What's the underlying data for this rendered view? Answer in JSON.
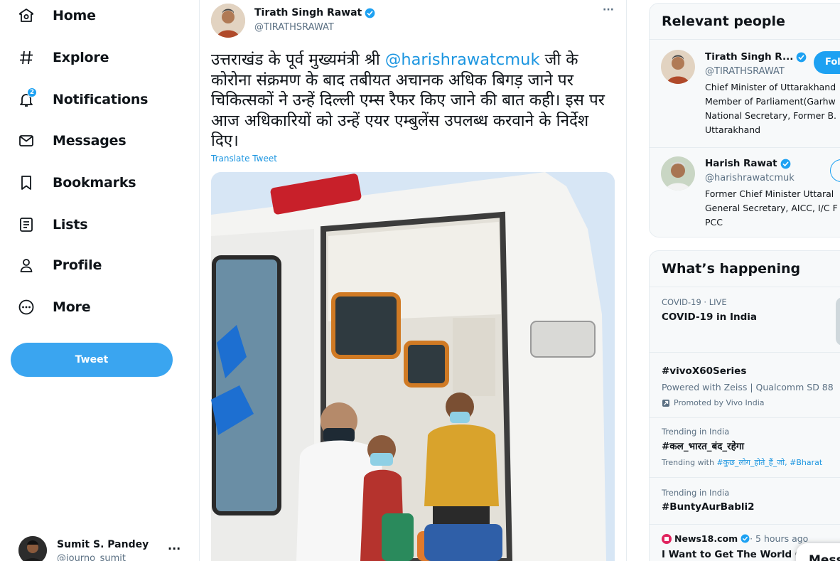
{
  "nav": {
    "items": [
      {
        "label": "Home",
        "icon": "home-icon"
      },
      {
        "label": "Explore",
        "icon": "hashtag-icon"
      },
      {
        "label": "Notifications",
        "icon": "bell-icon",
        "badge": "2"
      },
      {
        "label": "Messages",
        "icon": "envelope-icon"
      },
      {
        "label": "Bookmarks",
        "icon": "bookmark-icon"
      },
      {
        "label": "Lists",
        "icon": "list-icon"
      },
      {
        "label": "Profile",
        "icon": "person-icon"
      },
      {
        "label": "More",
        "icon": "more-circle-icon"
      }
    ],
    "tweet_button": "Tweet"
  },
  "account": {
    "name": "Sumit S. Pandey",
    "handle": "@journo_sumit",
    "more": "···"
  },
  "tweet": {
    "author_name": "Tirath Singh Rawat",
    "author_handle": "@TIRATHSRAWAT",
    "more": "···",
    "text_before": "उत्तराखंड के पूर्व मुख्यमंत्री श्री ",
    "mention": "@harishrawatcmuk",
    "text_after": " जी के कोरोना संक्रमण के बाद तबीयत अचानक अधिक बिगड़ जाने पर चिकित्सकों ने उन्हें दिल्ली एम्स रैफर किए जाने की बात कही। इस पर आज अधिकारियों को उन्हें एयर एम्बुलेंस उपलब्ध करवाने के निर्देश दिए।",
    "translate": "Translate Tweet",
    "photo_description": "ambulance-photo"
  },
  "relevant_people": {
    "title": "Relevant people",
    "people": [
      {
        "name": "Tirath Singh R...",
        "handle": "@TIRATHSRAWAT",
        "bio": "Chief Minister of Uttarakhand\nMember of Parliament(Garhw\nNational Secretary, Former B.\nUttarakhand",
        "follow": "Fol"
      },
      {
        "name": "Harish Rawat",
        "handle": "@harishrawatcmuk",
        "bio": "Former Chief Minister Uttaral\nGeneral Secretary, AICC, I/C F\nPCC"
      }
    ]
  },
  "whats_happening": {
    "title": "What’s happening",
    "items": [
      {
        "meta": "COVID-19 · LIVE",
        "title": "COVID-19 in India"
      },
      {
        "title": "#vivoX60Series",
        "sub": "Powered with Zeiss | Qualcomm SD 88",
        "promoted": "Promoted by Vivo India"
      },
      {
        "meta": "Trending in India",
        "title": "#कल_भारत_बंद_रहेगा",
        "small_prefix": "Trending with ",
        "small_links": "#कुछ_लोग_होते_हैं_जो, #Bharat"
      },
      {
        "meta": "Trending in India",
        "title": "#BuntyAurBabli2"
      },
      {
        "source": "News18.com",
        "time": " · 5 hours ago",
        "title": "I Want to Get The World Cu"
      }
    ]
  },
  "messages_popup": "Mess",
  "colors": {
    "accent": "#1da1f2",
    "link": "#1b95e0",
    "muted": "#5b7083",
    "live_red": "#e0245e"
  }
}
